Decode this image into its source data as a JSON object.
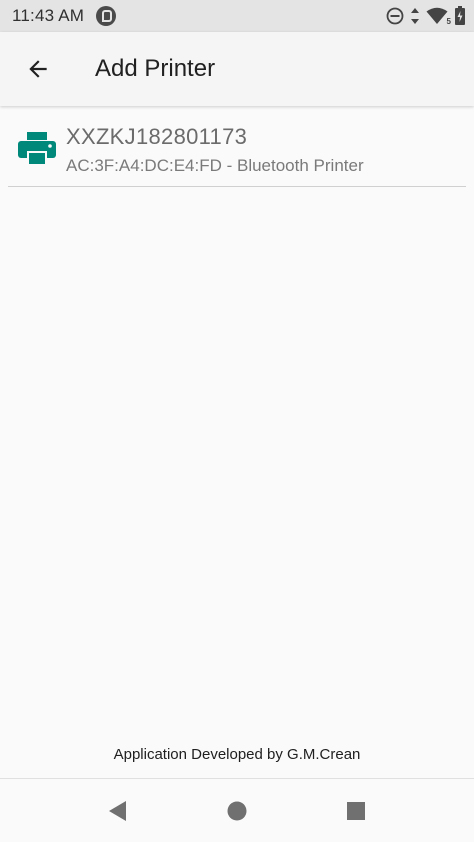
{
  "status_bar": {
    "time": "11:43 AM",
    "icons": [
      "app-notification-icon",
      "do-not-disturb-icon",
      "data-arrows-icon",
      "wifi-icon",
      "battery-icon"
    ],
    "wifi_badge": "5"
  },
  "app_bar": {
    "title": "Add Printer",
    "back_icon": "arrow-back-icon"
  },
  "printers": [
    {
      "name": "XXZKJ182801173",
      "detail": "AC:3F:A4:DC:E4:FD - Bluetooth Printer",
      "icon": "printer-icon"
    }
  ],
  "footer": {
    "credit": "Application Developed by G.M.Crean"
  },
  "nav": {
    "back": "back-triangle-icon",
    "home": "home-circle-icon",
    "recents": "recents-square-icon"
  },
  "colors": {
    "accent": "#00897b",
    "status_bar": "#e4e4e4",
    "app_bar": "#f5f5f5",
    "background": "#fafafa"
  }
}
